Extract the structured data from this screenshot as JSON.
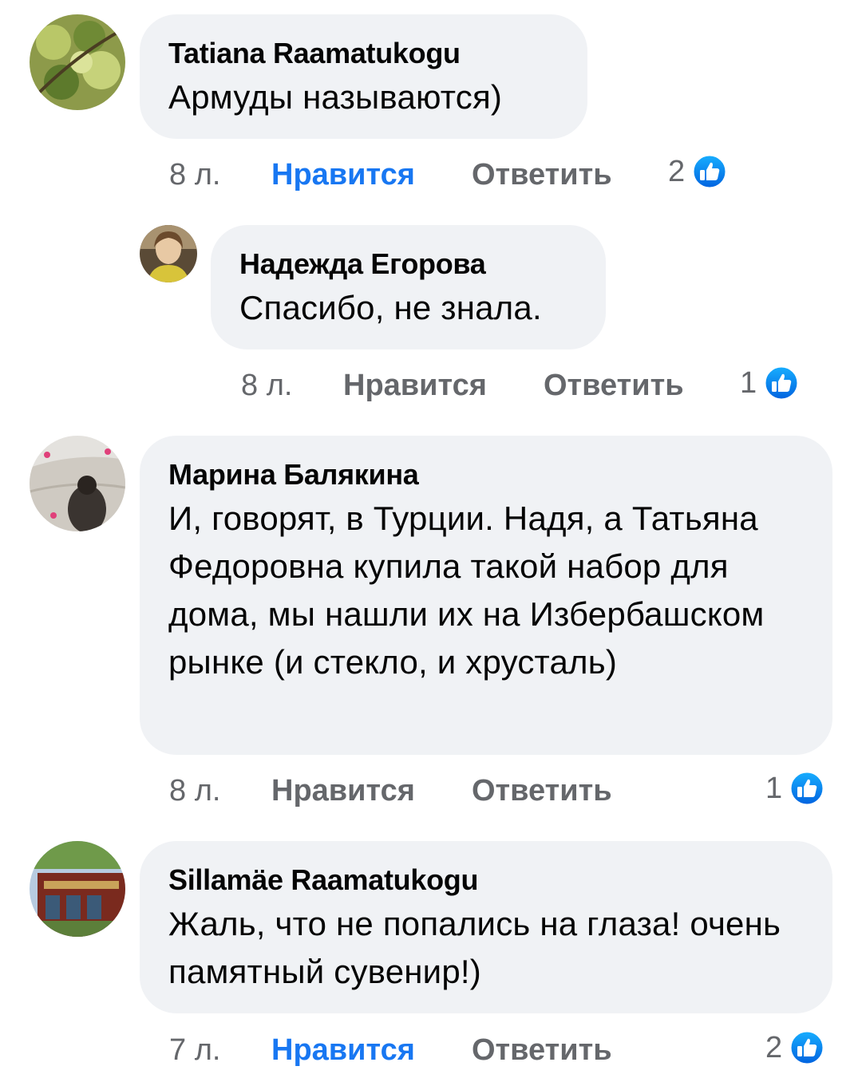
{
  "colors": {
    "bubble": "#f0f2f5",
    "meta": "#65676b",
    "accent": "#1877f2",
    "text": "#050505"
  },
  "comments": [
    {
      "author": "Tatiana Raamatukogu",
      "text": "Армуды называются)",
      "time": "8 л.",
      "like_label": "Нравится",
      "like_active": true,
      "reply_label": "Ответить",
      "reaction_count": "2",
      "reaction_icon": "thumbs-up-icon",
      "avatar_icon": "green-leaves-avatar"
    },
    {
      "author": "Надежда Егорова",
      "text": "Спасибо, не знала.",
      "time": "8 л.",
      "like_label": "Нравится",
      "like_active": false,
      "reply_label": "Ответить",
      "reaction_count": "1",
      "reaction_icon": "thumbs-up-icon",
      "avatar_icon": "woman-portrait-avatar",
      "is_reply": true
    },
    {
      "author": "Марина Балякина",
      "text": "И, говорят, в Турции. Надя, а Татьяна Федоровна купила такой набор для дома, мы нашли их на Избербашском рынке (и стекло, и хрусталь)",
      "time": "8 л.",
      "like_label": "Нравится",
      "like_active": false,
      "reply_label": "Ответить",
      "reaction_count": "1",
      "reaction_icon": "thumbs-up-icon",
      "avatar_icon": "beach-silhouette-avatar"
    },
    {
      "author": "Sillamäe Raamatukogu",
      "text": "Жаль, что не попались на глаза! очень памятный сувенир!)",
      "time": "7 л.",
      "like_label": "Нравится",
      "like_active": true,
      "reply_label": "Ответить",
      "reaction_count": "2",
      "reaction_icon": "thumbs-up-icon",
      "avatar_icon": "library-building-avatar"
    }
  ]
}
